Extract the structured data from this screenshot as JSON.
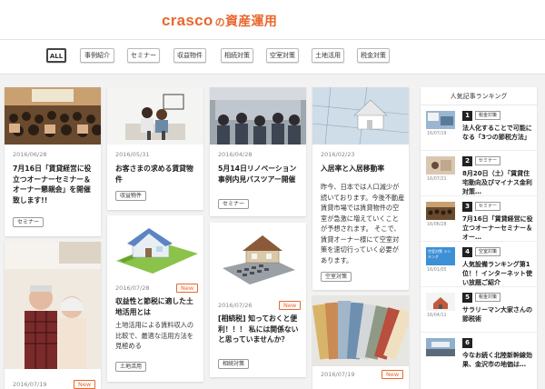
{
  "header": {
    "brand": "crasco",
    "particle": "の",
    "service": "資産運用"
  },
  "nav": {
    "tabs": [
      {
        "label": "ALL",
        "active": true
      },
      {
        "label": "事例紹介"
      },
      {
        "label": "セミナー"
      },
      {
        "label": "収益物件"
      },
      {
        "label": "相続対策"
      },
      {
        "label": "空室対策"
      },
      {
        "label": "土地活用"
      },
      {
        "label": "税金対策"
      }
    ]
  },
  "cards": {
    "c1": {
      "date": "2016/06/28",
      "title": "7月16日「賃貸経営に役立つオーナーセミナー＆オーナー懇親会」を開催致します!!",
      "tag": "セミナー"
    },
    "c2": {
      "date": "2016/05/31",
      "title": "お客さまの求める賃貸物件",
      "tag": "収益物件"
    },
    "c3": {
      "date": "2016/04/28",
      "title": "5月14日リノベーション事例内見バスツアー開催",
      "tag": "セミナー"
    },
    "c4": {
      "date": "2016/02/23",
      "title": "入居率と入居移動率",
      "body": "昨今、日本では人口減少が続いております。今後不動産賃貸市場では賃貸物件の空室が急激に増えていくことが予想されます。 そこで、賃貸オーナー様にて空室対策を速切行っていく必要があります。",
      "tag": "空室対策"
    },
    "c5": {
      "date": "2016/07/28",
      "new": "New",
      "title": "収益性と節税に適した土地活用とは",
      "body": "土地活用による賃料収入の比較で、最適な活用方法を見極める",
      "tag": "土地活用"
    },
    "c6": {
      "date": "2016/07/26",
      "new": "New",
      "title": "[相続税] 知っておくと便利！！！ 私には関係ないと思っていませんか？",
      "tag": "相続対策"
    },
    "c7": {
      "date": "2016/07/19",
      "new": "New"
    },
    "c8": {
      "date": "2016/07/19",
      "new": "New"
    }
  },
  "sidebar": {
    "heading": "人気記事ランキング",
    "items": [
      {
        "num": "1",
        "tag": "税金対策",
        "date": "16/07/19",
        "title": "法人化することで可能になる「3つの節税方法」"
      },
      {
        "num": "2",
        "tag": "セミナー",
        "date": "16/07/21",
        "title": "8月20日（土）「賃貸住宅動向及びマイナス金利対策…"
      },
      {
        "num": "3",
        "tag": "セミナー",
        "date": "16/06/28",
        "title": "7月16日「賃貸経営に役立つオーナーセミナー＆オー…"
      },
      {
        "num": "4",
        "tag": "空室対策",
        "date": "16/01/05",
        "thumb_text": "空室対策 ランキング",
        "title": "人気設備ランキング第1位！！インターネット使い放題ご紹介"
      },
      {
        "num": "5",
        "tag": "税金対策",
        "date": "16/04/11",
        "title": "サラリーマン大家さんの節税術"
      },
      {
        "num": "6",
        "tag": "",
        "date": "",
        "title": "今なお続く北陸新幹線効果、金沢市の地価は…"
      }
    ]
  },
  "colors": {
    "accent": "#e9672d",
    "background": "#f2f2f2",
    "card": "#ffffff"
  }
}
